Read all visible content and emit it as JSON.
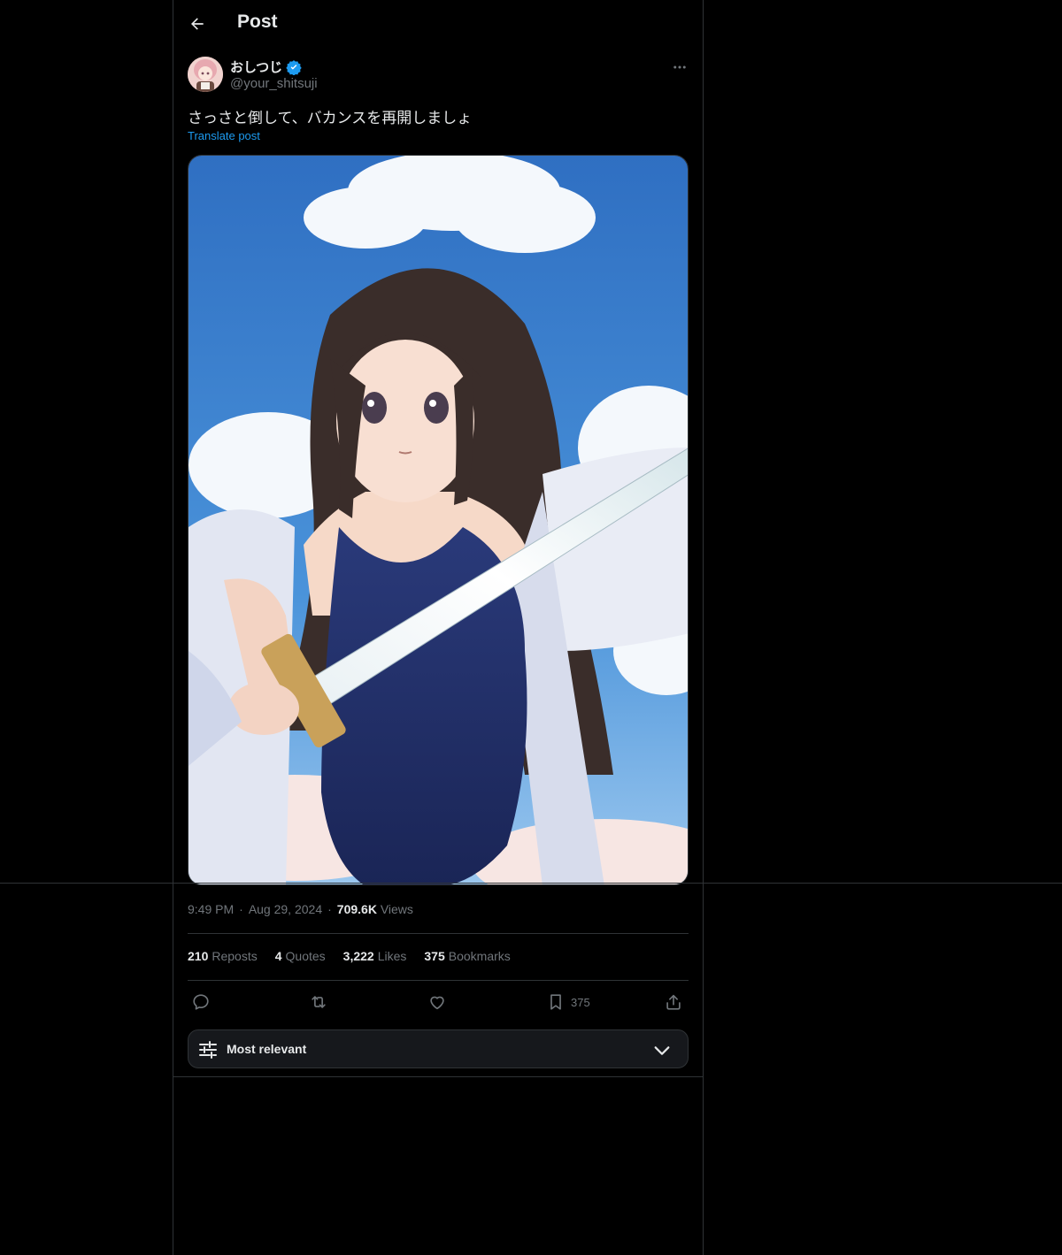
{
  "header": {
    "title": "Post"
  },
  "post": {
    "author": {
      "display_name": "おしつじ",
      "handle": "@your_shitsuji",
      "verified": true
    },
    "text": "さっさと倒して、バカンスを再開しましょ",
    "translate_label": "Translate post",
    "time": "9:49 PM",
    "date": "Aug 29, 2024",
    "views_count": "709.6K",
    "views_label": "Views",
    "separator": "·"
  },
  "stats": {
    "reposts": {
      "count": "210",
      "label": "Reposts"
    },
    "quotes": {
      "count": "4",
      "label": "Quotes"
    },
    "likes": {
      "count": "3,222",
      "label": "Likes"
    },
    "bookmarks": {
      "count": "375",
      "label": "Bookmarks"
    }
  },
  "actions": {
    "bookmark_count": "375"
  },
  "sort": {
    "label": "Most relevant"
  },
  "colors": {
    "background": "#000000",
    "text": "#e7e9ea",
    "muted": "#71767b",
    "accent": "#1d9bf0",
    "border": "#2f3336"
  }
}
